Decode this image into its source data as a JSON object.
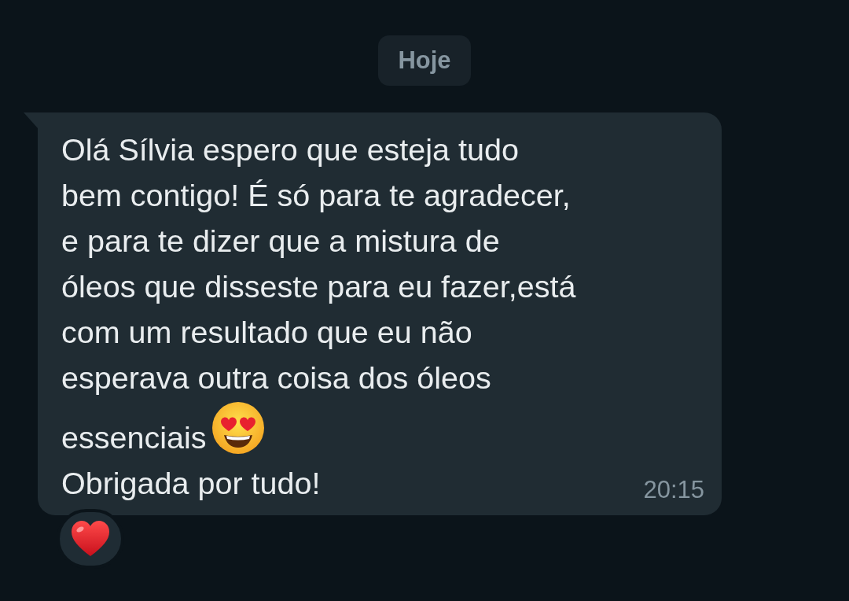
{
  "date_divider": "Hoje",
  "message": {
    "parts": [
      {
        "kind": "text",
        "text": "Olá Sílvia espero que esteja tudo\nbem contigo! É só para te agradecer,\ne para te dizer que a mistura de\nóleos que disseste para eu fazer,está\ncom um resultado que eu não\nesperava outra coisa dos óleos"
      },
      {
        "kind": "text",
        "text": "essenciais"
      },
      {
        "kind": "heart_eyes_emoji"
      },
      {
        "kind": "text",
        "text": "Obrigada por tudo!"
      }
    ],
    "time": "20:15",
    "reaction": {
      "kind": "red_heart"
    }
  }
}
